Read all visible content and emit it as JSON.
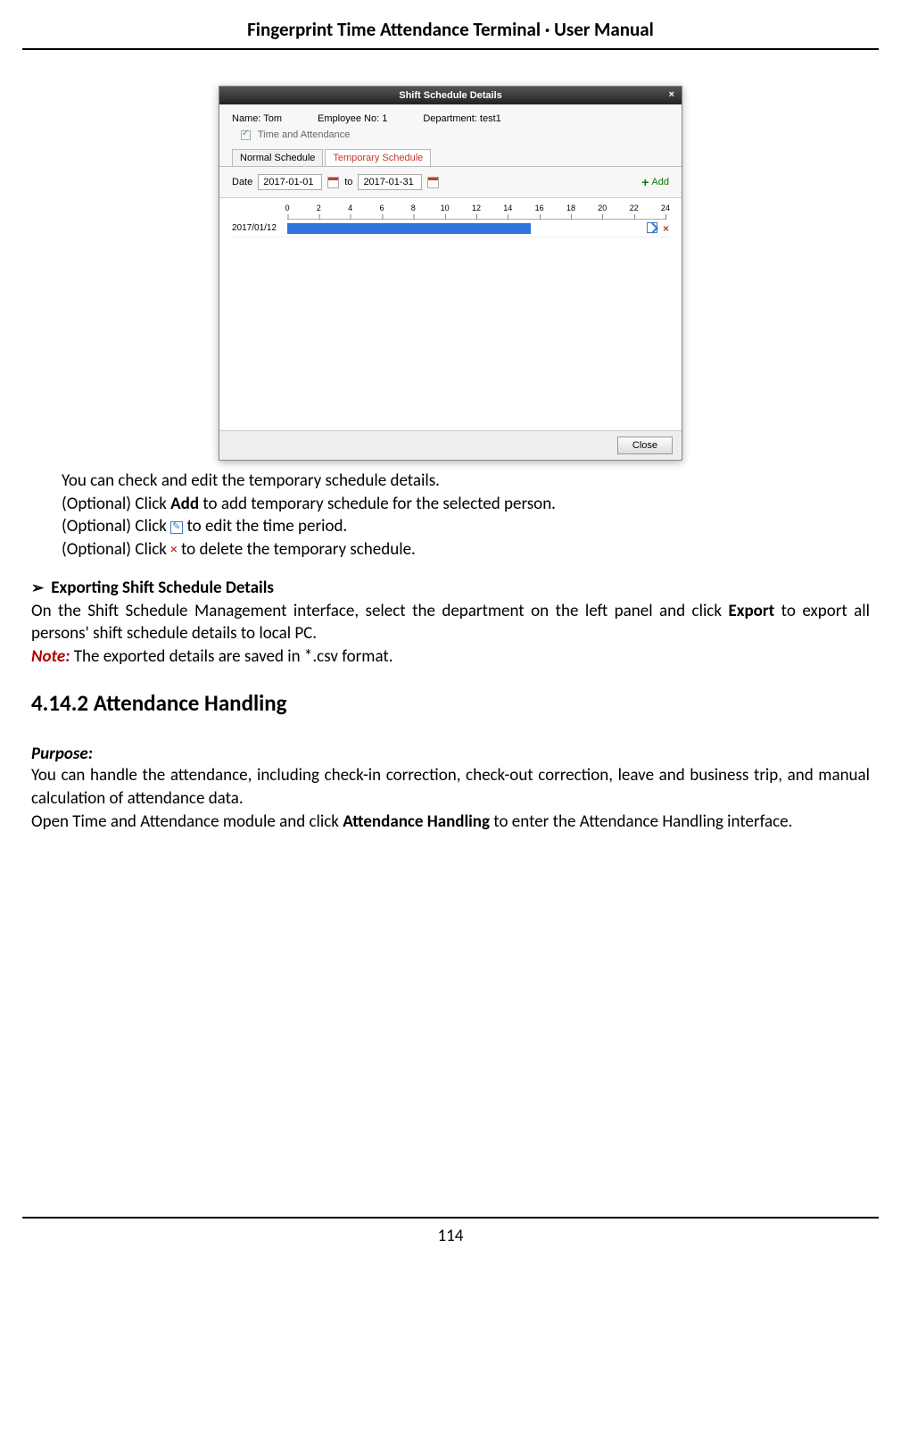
{
  "header": {
    "title": "Fingerprint Time Attendance Terminal · User Manual"
  },
  "dialog": {
    "title": "Shift Schedule Details",
    "close_x": "×",
    "name_label": "Name: Tom",
    "emp_label": "Employee No: 1",
    "dept_label": "Department: test1",
    "checkbox_label": "Time and Attendance",
    "tab_normal": "Normal Schedule",
    "tab_temp": "Temporary Schedule",
    "date_label": "Date",
    "date_from": "2017-01-01",
    "date_to_label": "to",
    "date_to": "2017-01-31",
    "add_label": "Add",
    "ruler_ticks": [
      "0",
      "2",
      "4",
      "6",
      "8",
      "10",
      "12",
      "14",
      "16",
      "18",
      "20",
      "22",
      "24"
    ],
    "row_date": "2017/01/12",
    "close_btn": "Close"
  },
  "body": {
    "line1": "You can check and edit the temporary schedule details.",
    "line2a": "(Optional) Click ",
    "line2b": "Add",
    "line2c": " to add temporary schedule for the selected person.",
    "line3a": "(Optional) Click ",
    "line3b": " to edit the time period.",
    "line4a": "(Optional) Click ",
    "line4b": " to delete the temporary schedule.",
    "export_head": "Exporting Shift Schedule Details",
    "export_p1": "On the Shift Schedule Management interface, select the department on the left panel and click ",
    "export_bold": "Export",
    "export_p2": " to export all persons' shift schedule details to local PC.",
    "note_label": "Note:",
    "note_text": " The exported details are saved in *.csv format.",
    "section_h": "4.14.2 Attendance Handling",
    "purpose_label": "Purpose:",
    "purpose_p1": "You can handle the attendance, including check-in correction, check-out correction, leave and business trip, and manual calculation of attendance data.",
    "purpose_p2a": "Open Time and Attendance module and click ",
    "purpose_p2b": "Attendance Handling",
    "purpose_p2c": " to enter the Attendance Handling interface."
  },
  "page_number": "114"
}
